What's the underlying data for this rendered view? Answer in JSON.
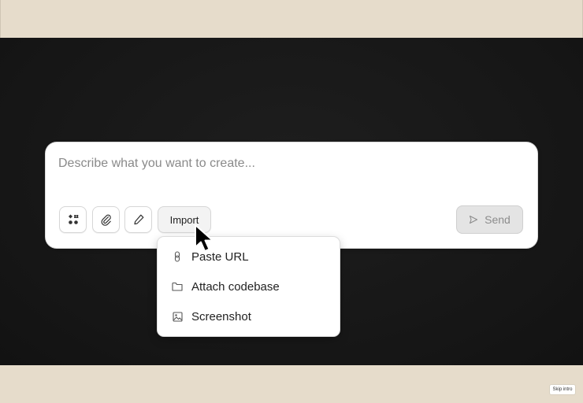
{
  "composer": {
    "placeholder": "Describe what you want to create...",
    "import_label": "Import",
    "send_label": "Send",
    "tools": [
      {
        "icon": "components-icon"
      },
      {
        "icon": "paperclip-icon"
      },
      {
        "icon": "pencil-icon"
      }
    ]
  },
  "import_menu": {
    "items": [
      {
        "label": "Paste URL",
        "icon": "link-icon"
      },
      {
        "label": "Attach codebase",
        "icon": "folder-icon"
      },
      {
        "label": "Screenshot",
        "icon": "image-icon"
      }
    ]
  },
  "footer": {
    "skip_label": "Skip intro"
  }
}
